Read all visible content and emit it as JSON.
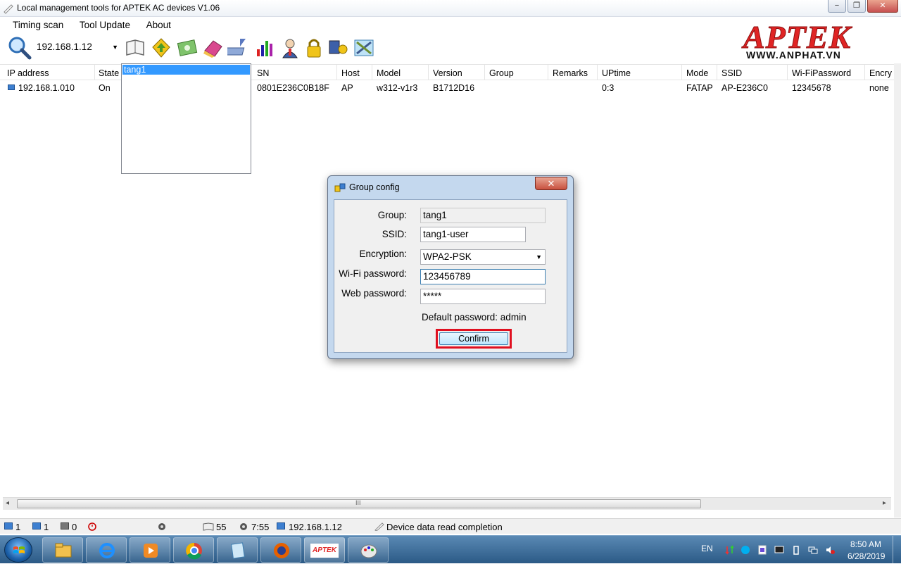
{
  "window": {
    "title": "Local management tools for APTEK AC devices  V1.06",
    "min": "−",
    "max": "❐",
    "close": "✕"
  },
  "menu": [
    "Timing scan",
    "Tool Update",
    "About"
  ],
  "toolbar": {
    "ip": "192.168.1.12"
  },
  "logo": {
    "brand": "APTEK",
    "url": "WWW.ANPHAT.VN",
    "color": "#e02424"
  },
  "table": {
    "columns": [
      "IP address",
      "State",
      "SN",
      "Host",
      "Model",
      "Version",
      "Group",
      "Remarks",
      "UPtime",
      "Mode",
      "SSID",
      "Wi-FiPassword",
      "Encry"
    ],
    "rows": [
      {
        "ip": "192.168.1.010",
        "state": "On",
        "sn": "0801E236C0B18F",
        "host": "AP",
        "model": "w312-v1r3",
        "version": "B1712D16",
        "group": "",
        "remarks": "",
        "uptime": "0:3",
        "mode": "FATAP",
        "ssid": "AP-E236C0",
        "wifi_password": "12345678",
        "encryption": "none"
      }
    ]
  },
  "group_list": {
    "items": [
      "tang1"
    ]
  },
  "dialog": {
    "title": "Group config",
    "close": "✕",
    "group_label": "Group:",
    "group_value": "tang1",
    "ssid_label": "SSID:",
    "ssid_value": "tang1-user",
    "enc_label": "Encryption:",
    "enc_value": "WPA2-PSK",
    "wifi_label": "Wi-Fi password:",
    "wifi_value": "123456789",
    "web_label": "Web password:",
    "web_value": "*****",
    "default_note": "Default password: admin",
    "confirm": "Confirm"
  },
  "scrollbar": {
    "left": "◂",
    "right": "▸",
    "grip": "III"
  },
  "status": {
    "count_a": "1",
    "count_b": "1",
    "count_c": "0",
    "packets": "55",
    "time": "7:55",
    "ip": "192.168.1.12",
    "message": "Device data read completion"
  },
  "taskbar": {
    "lang": "EN",
    "clock_time": "8:50 AM",
    "clock_date": "6/28/2019",
    "apptek_label": "APTEK"
  }
}
